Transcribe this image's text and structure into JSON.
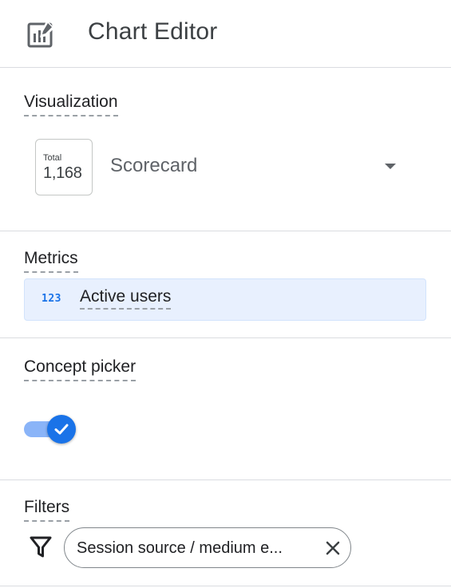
{
  "header": {
    "title": "Chart Editor",
    "icon": "chart-editor-icon"
  },
  "visualization": {
    "label": "Visualization",
    "thumbnail": {
      "label": "Total",
      "value": "1,168"
    },
    "selected": "Scorecard",
    "dropdown_icon": "arrow-drop-down-icon"
  },
  "metrics": {
    "label": "Metrics",
    "items": [
      {
        "type_icon": "123",
        "name": "Active users"
      }
    ]
  },
  "concept_picker": {
    "label": "Concept picker",
    "enabled": true,
    "accent_color": "#1a73e8",
    "track_color": "#8ab4f8"
  },
  "filters": {
    "label": "Filters",
    "icon": "filter-funnel-icon",
    "chips": [
      {
        "text": "Session source / medium e...",
        "close_icon": "close-icon"
      }
    ]
  }
}
